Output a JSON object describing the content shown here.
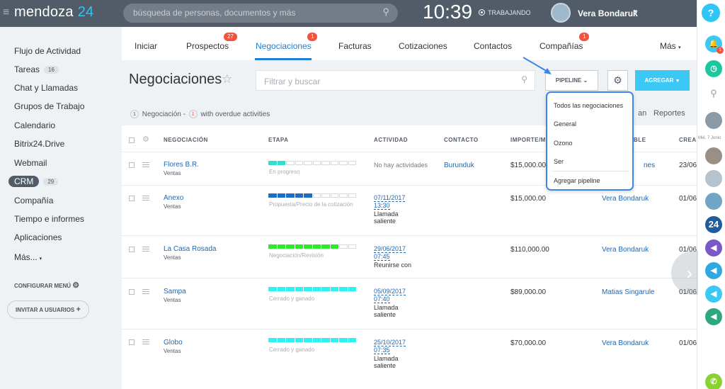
{
  "header": {
    "logo_text": "mendoza",
    "logo_num": "24",
    "search_placeholder": "búsqueda de personas, documentos y más",
    "clock": "10:39",
    "status": "TRABAJANDO",
    "user_name": "Vera Bondaruk"
  },
  "sidebar": {
    "items": [
      {
        "label": "Flujo de Actividad"
      },
      {
        "label": "Tareas",
        "badge": "16"
      },
      {
        "label": "Chat y Llamadas"
      },
      {
        "label": "Grupos de Trabajo"
      },
      {
        "label": "Calendario"
      },
      {
        "label": "Bitrix24.Drive"
      },
      {
        "label": "Webmail"
      },
      {
        "label": "CRM",
        "badge": "29"
      },
      {
        "label": "Compañía"
      },
      {
        "label": "Tiempo e informes"
      },
      {
        "label": "Aplicaciones"
      },
      {
        "label": "Más..."
      }
    ],
    "configure": "CONFIGURAR MENÚ",
    "invite": "INVITAR A USUARIOS"
  },
  "tabs": [
    {
      "label": "Iniciar"
    },
    {
      "label": "Prospectos",
      "badge": "27"
    },
    {
      "label": "Negociaciones",
      "badge": "1",
      "active": true
    },
    {
      "label": "Facturas"
    },
    {
      "label": "Cotizaciones"
    },
    {
      "label": "Contactos"
    },
    {
      "label": "Compañías",
      "badge": "1"
    },
    {
      "label": "Más"
    }
  ],
  "page": {
    "title": "Negociaciones",
    "filter_placeholder": "Filtrar y buscar",
    "pipeline_label": "PIPELINE",
    "add_label": "AGREGAR",
    "counter_count": "1",
    "counter_text": "Negociación -",
    "counter_overdue": "1",
    "counter_suffix": "with overdue activities",
    "right_link_1": "an",
    "right_link_2": "Reportes"
  },
  "table": {
    "columns": [
      "NEGOCIACIÓN",
      "ETAPA",
      "ACTIVIDAD",
      "CONTACTO",
      "IMPORTE/M",
      "BLE",
      "CREA"
    ],
    "rows": [
      {
        "name": "Flores B.R.",
        "category": "Ventas",
        "stage": "En progreso",
        "stage_filled": 2,
        "stage_color": "#2fe0cf",
        "activity_date": "",
        "activity_time": "",
        "activity_type": "No hay actividades",
        "contact": "Burunduk",
        "amount": "$15,000.00",
        "responsible": "nes",
        "created": "23/06"
      },
      {
        "name": "Anexo",
        "category": "Ventas",
        "stage": "Propuesta/Precio de la cotización",
        "stage_filled": 5,
        "stage_color": "#1e6ec8",
        "activity_date": "07/11/2017",
        "activity_time": "13:30",
        "activity_type": "Llamada saliente",
        "contact": "",
        "amount": "$15,000.00",
        "responsible": "Vera Bondaruk",
        "created": "01/06"
      },
      {
        "name": "La Casa Rosada",
        "category": "Ventas",
        "stage": "Negociación/Revisión",
        "stage_filled": 8,
        "stage_color": "#2ee92e",
        "activity_date": "29/06/2017",
        "activity_time": "07:45",
        "activity_type": "Reunirse con",
        "contact": "",
        "amount": "$110,000.00",
        "responsible": "Vera Bondaruk",
        "created": "01/06"
      },
      {
        "name": "Sampa",
        "category": "Ventas",
        "stage": "Cerrado y ganado",
        "stage_filled": 10,
        "stage_color": "#2ff2f2",
        "activity_date": "05/09/2017",
        "activity_time": "07:40",
        "activity_type": "Llamada saliente",
        "contact": "",
        "amount": "$89,000.00",
        "responsible": "Matias Singarule",
        "created": "01/06"
      },
      {
        "name": "Globo",
        "category": "Ventas",
        "stage": "Cerrado y ganado",
        "stage_filled": 10,
        "stage_color": "#2ff2f2",
        "activity_date": "25/10/2017",
        "activity_time": "07:35",
        "activity_type": "Llamada saliente",
        "contact": "",
        "amount": "$70,000.00",
        "responsible": "Vera Bondaruk",
        "created": "01/06"
      }
    ]
  },
  "pipeline_dropdown": {
    "items": [
      "Todos las negociaciones",
      "General",
      "Ozono",
      "Ser",
      "Agregar pipeline"
    ]
  },
  "rightbar": {
    "help": "?",
    "date_label": "Mié, 7 Junio",
    "b24": "24"
  }
}
